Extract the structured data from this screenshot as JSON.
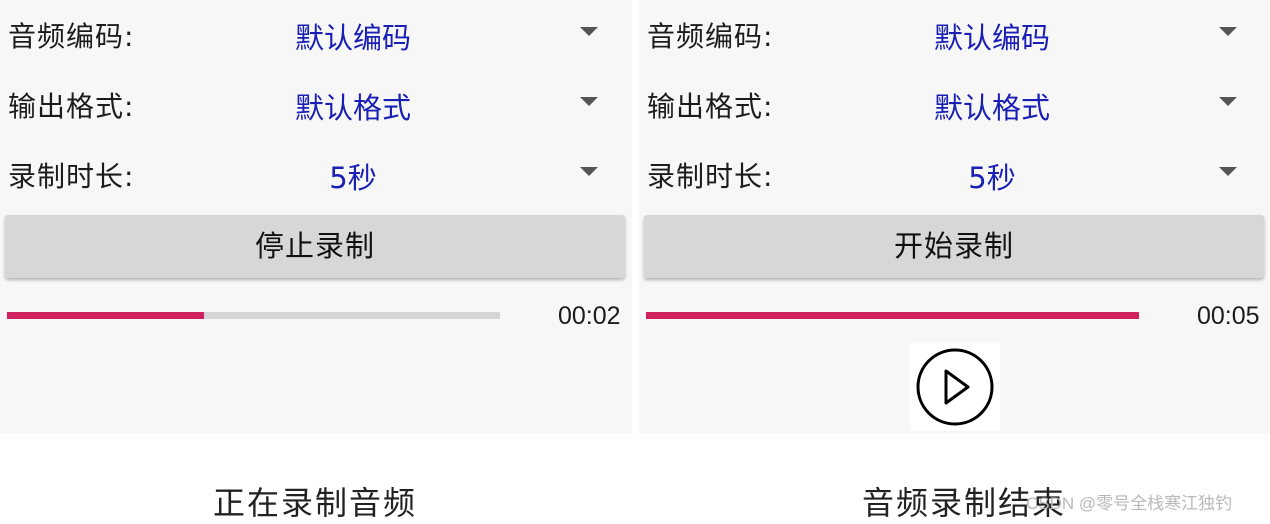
{
  "panels": [
    {
      "rows": [
        {
          "label": "音频编码:",
          "value": "默认编码"
        },
        {
          "label": "输出格式:",
          "value": "默认格式"
        },
        {
          "label": "录制时长:",
          "value": "5秒"
        }
      ],
      "button_label": "停止录制",
      "progress": 0.4,
      "time": "00:02",
      "caption": "正在录制音频"
    },
    {
      "rows": [
        {
          "label": "音频编码:",
          "value": "默认编码"
        },
        {
          "label": "输出格式:",
          "value": "默认格式"
        },
        {
          "label": "录制时长:",
          "value": "5秒"
        }
      ],
      "button_label": "开始录制",
      "progress": 1.0,
      "time": "00:05",
      "caption": "音频录制结束",
      "play_icon": "play-circle-icon"
    }
  ],
  "watermark": "CSDN @零号全栈寒江独钓",
  "colors": {
    "value_text": "#1a1fb5",
    "progress_fill": "#d1215e",
    "progress_track": "#d5d5d5",
    "button_bg": "#d6d7d7",
    "panel_bg": "#f7f7f7"
  }
}
